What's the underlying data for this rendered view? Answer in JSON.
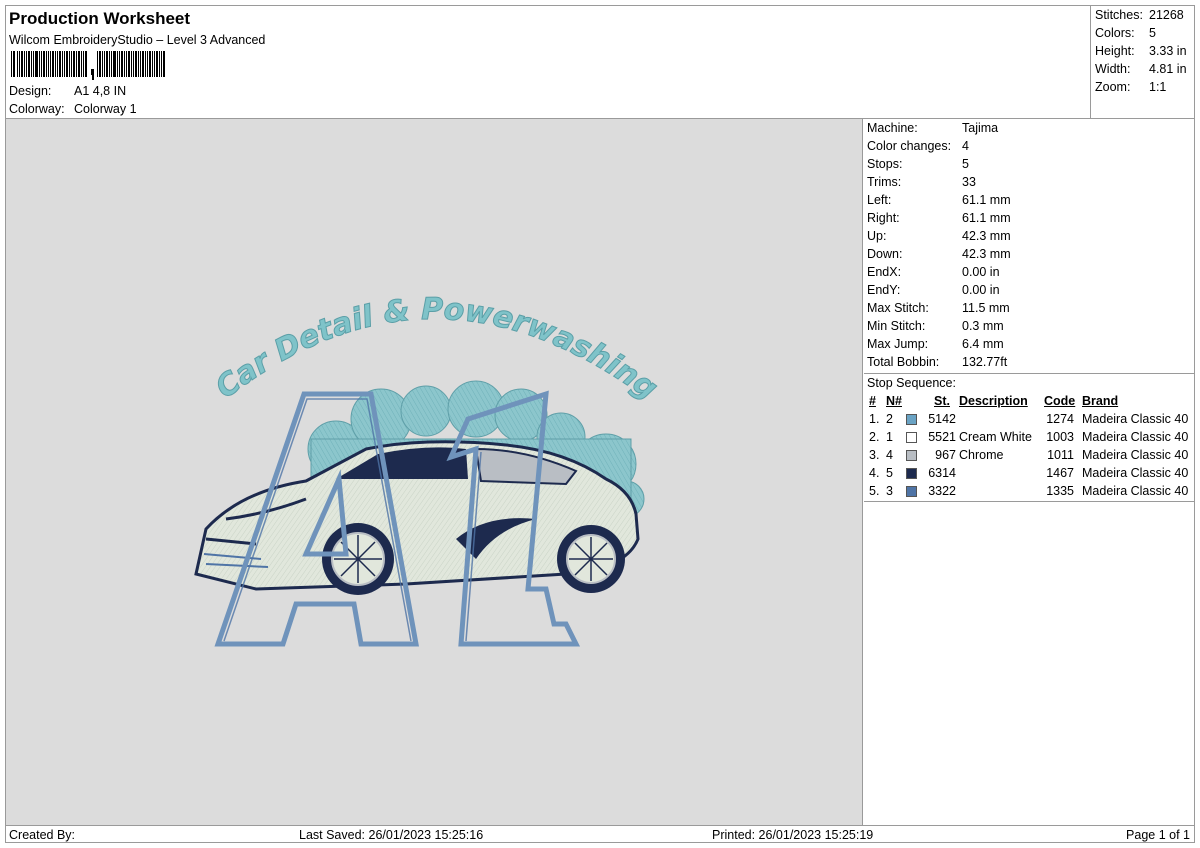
{
  "header": {
    "title": "Production Worksheet",
    "subtitle": "Wilcom EmbroideryStudio – Level 3 Advanced",
    "design_label": "Design:",
    "design_value": "A1 4,8 IN",
    "colorway_label": "Colorway:",
    "colorway_value": "Colorway 1"
  },
  "summary": {
    "stitches_label": "Stitches:",
    "stitches_value": "21268",
    "colors_label": "Colors:",
    "colors_value": "5",
    "height_label": "Height:",
    "height_value": "3.33 in",
    "width_label": "Width:",
    "width_value": "4.81 in",
    "zoom_label": "Zoom:",
    "zoom_value": "1:1"
  },
  "machine_info": [
    {
      "label": "Machine:",
      "value": "Tajima"
    },
    {
      "label": "Color changes:",
      "value": "4"
    },
    {
      "label": "Stops:",
      "value": "5"
    },
    {
      "label": "Trims:",
      "value": "33"
    },
    {
      "label": "Left:",
      "value": "61.1 mm"
    },
    {
      "label": "Right:",
      "value": "61.1 mm"
    },
    {
      "label": "Up:",
      "value": "42.3 mm"
    },
    {
      "label": "Down:",
      "value": "42.3 mm"
    },
    {
      "label": "EndX:",
      "value": "0.00 in"
    },
    {
      "label": "EndY:",
      "value": "0.00 in"
    },
    {
      "label": "Max Stitch:",
      "value": "11.5 mm"
    },
    {
      "label": "Min Stitch:",
      "value": "0.3 mm"
    },
    {
      "label": "Max Jump:",
      "value": "6.4 mm"
    },
    {
      "label": "Total Bobbin:",
      "value": "132.77ft"
    }
  ],
  "stop_sequence": {
    "title": "Stop Sequence:",
    "headers": {
      "num": "#",
      "n": "N#",
      "st": "St.",
      "desc": "Description",
      "code": "Code",
      "brand": "Brand"
    },
    "rows": [
      {
        "num": "1.",
        "n": "2",
        "color": "#6aa3c4",
        "st": "5142",
        "desc": "",
        "code": "1274",
        "brand": "Madeira Classic 40"
      },
      {
        "num": "2.",
        "n": "1",
        "color": "#ffffff",
        "st": "5521",
        "desc": "Cream White",
        "code": "1003",
        "brand": "Madeira Classic 40"
      },
      {
        "num": "3.",
        "n": "4",
        "color": "#b9bec4",
        "st": "967",
        "desc": "Chrome",
        "code": "1011",
        "brand": "Madeira Classic 40"
      },
      {
        "num": "4.",
        "n": "5",
        "color": "#1d2a4e",
        "st": "6314",
        "desc": "",
        "code": "1467",
        "brand": "Madeira Classic 40"
      },
      {
        "num": "5.",
        "n": "3",
        "color": "#4f74a6",
        "st": "3322",
        "desc": "",
        "code": "1335",
        "brand": "Madeira Classic 40"
      }
    ]
  },
  "design_art": {
    "arched_text": "Car Detail & Powerwashing",
    "text_color": "#7fc3c9",
    "outline_color": "#6f93bb",
    "dark_color": "#1d2a4e",
    "body_color": "#e1e7dc"
  },
  "footer": {
    "created_by": "Created By:",
    "last_saved": "Last Saved: 26/01/2023 15:25:16",
    "printed": "Printed: 26/01/2023 15:25:19",
    "page": "Page 1 of 1"
  }
}
